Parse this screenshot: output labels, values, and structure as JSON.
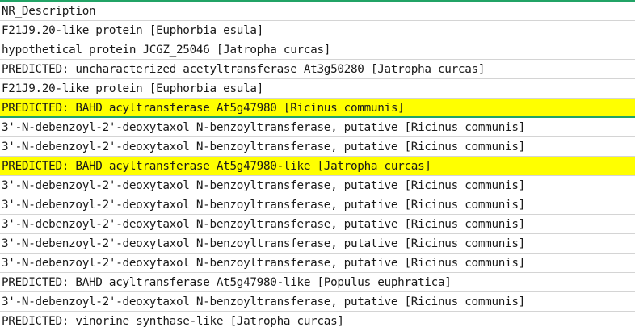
{
  "spreadsheet": {
    "colors": {
      "highlight": "#ffff00",
      "selection_border": "#21a366",
      "gridline": "#d4d4d4"
    },
    "rows": [
      {
        "text": "NR_Description",
        "highlight": false
      },
      {
        "text": "F21J9.20-like protein [Euphorbia esula]",
        "highlight": false
      },
      {
        "text": "hypothetical protein JCGZ_25046 [Jatropha curcas]",
        "highlight": false
      },
      {
        "text": "PREDICTED: uncharacterized acetyltransferase At3g50280 [Jatropha curcas]",
        "highlight": false
      },
      {
        "text": "F21J9.20-like protein [Euphorbia esula]",
        "highlight": false
      },
      {
        "text": "PREDICTED: BAHD acyltransferase At5g47980 [Ricinus communis]",
        "highlight": true,
        "selected": true
      },
      {
        "text": "3'-N-debenzoyl-2'-deoxytaxol N-benzoyltransferase, putative [Ricinus communis]",
        "highlight": false
      },
      {
        "text": "3'-N-debenzoyl-2'-deoxytaxol N-benzoyltransferase, putative [Ricinus communis]",
        "highlight": false
      },
      {
        "text": "PREDICTED: BAHD acyltransferase At5g47980-like [Jatropha curcas]",
        "highlight": true
      },
      {
        "text": "3'-N-debenzoyl-2'-deoxytaxol N-benzoyltransferase, putative [Ricinus communis]",
        "highlight": false
      },
      {
        "text": "3'-N-debenzoyl-2'-deoxytaxol N-benzoyltransferase, putative [Ricinus communis]",
        "highlight": false
      },
      {
        "text": "3'-N-debenzoyl-2'-deoxytaxol N-benzoyltransferase, putative [Ricinus communis]",
        "highlight": false
      },
      {
        "text": "3'-N-debenzoyl-2'-deoxytaxol N-benzoyltransferase, putative [Ricinus communis]",
        "highlight": false
      },
      {
        "text": "3'-N-debenzoyl-2'-deoxytaxol N-benzoyltransferase, putative [Ricinus communis]",
        "highlight": false
      },
      {
        "text": "PREDICTED: BAHD acyltransferase At5g47980-like [Populus euphratica]",
        "highlight": false
      },
      {
        "text": "3'-N-debenzoyl-2'-deoxytaxol N-benzoyltransferase, putative [Ricinus communis]",
        "highlight": false
      },
      {
        "text": "PREDICTED: vinorine synthase-like [Jatropha curcas]",
        "highlight": false
      }
    ]
  }
}
